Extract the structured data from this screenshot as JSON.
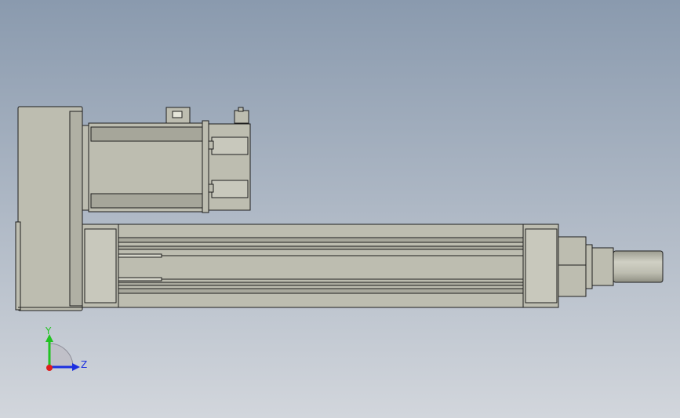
{
  "viewport": {
    "background_top": "#8a9aae",
    "background_bottom": "#d2d6dc"
  },
  "model": {
    "body_color": "#bdbdb0",
    "body_light": "#d4d4c8",
    "body_dark": "#9c9c90",
    "outline_color": "#1e1e1e"
  },
  "triad": {
    "y_label": "Y",
    "z_label": "Z",
    "y_color": "#22c322",
    "z_color": "#1c2fe0",
    "x_color": "#e01c1c"
  }
}
